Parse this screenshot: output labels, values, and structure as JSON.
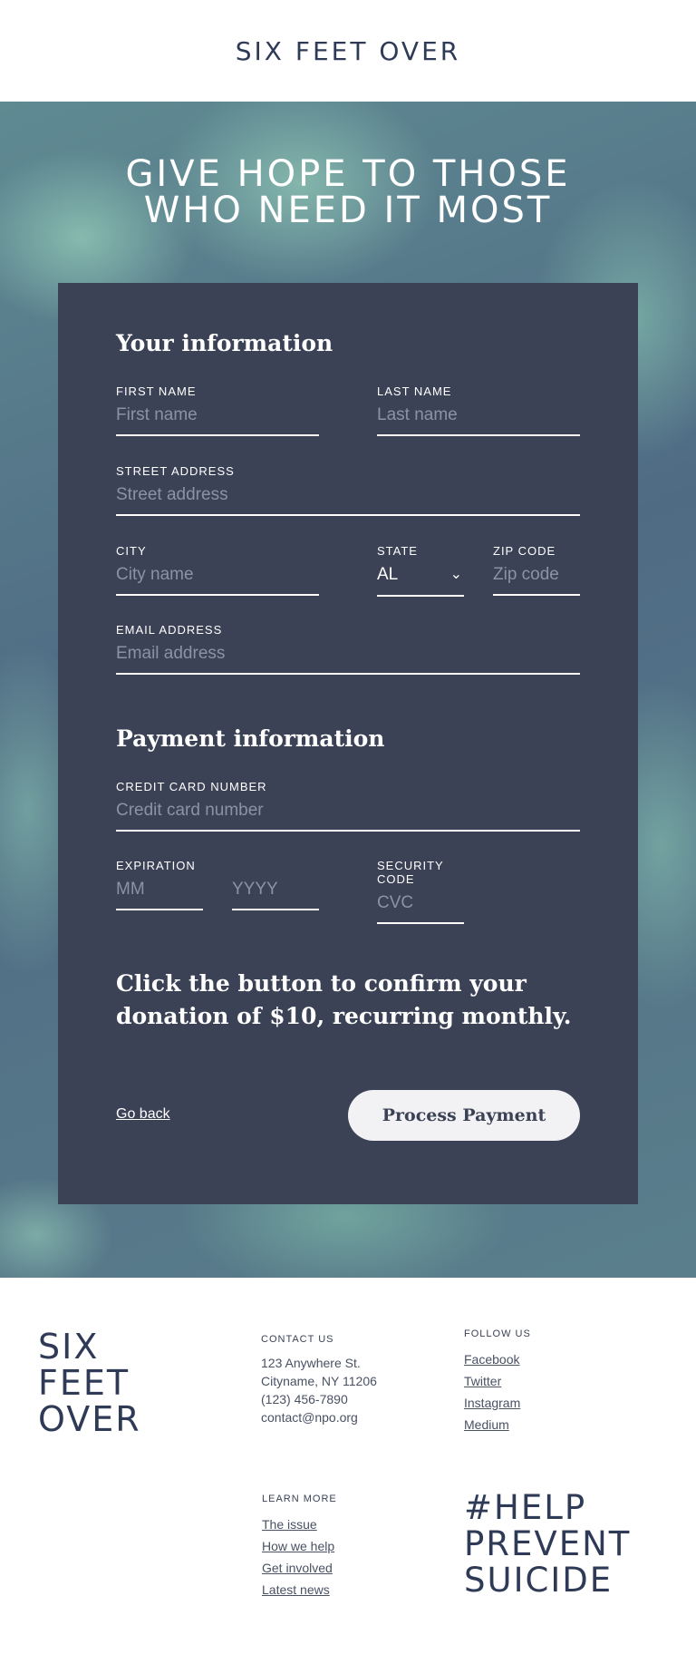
{
  "header": {
    "brand": "SIX FEET OVER"
  },
  "hero": {
    "title_line1": "GIVE HOPE TO THOSE",
    "title_line2": "WHO NEED IT MOST"
  },
  "form": {
    "your_info_heading": "Your information",
    "first_name": {
      "label": "FIRST NAME",
      "placeholder": "First name"
    },
    "last_name": {
      "label": "LAST NAME",
      "placeholder": "Last name"
    },
    "street": {
      "label": "STREET ADDRESS",
      "placeholder": "Street address"
    },
    "city": {
      "label": "CITY",
      "placeholder": "City name"
    },
    "state": {
      "label": "STATE",
      "value": "AL"
    },
    "zip": {
      "label": "ZIP CODE",
      "placeholder": "Zip code"
    },
    "email": {
      "label": "EMAIL ADDRESS",
      "placeholder": "Email address"
    },
    "payment_heading": "Payment information",
    "card": {
      "label": "CREDIT CARD NUMBER",
      "placeholder": "Credit card number"
    },
    "expiration": {
      "label": "EXPIRATION",
      "month_placeholder": "MM",
      "year_placeholder": "YYYY"
    },
    "security": {
      "label": "SECURITY CODE",
      "placeholder": "CVC"
    },
    "confirm_text": "Click the button to confirm your donation of $10, recurring monthly.",
    "go_back": "Go back",
    "submit": "Process Payment"
  },
  "footer": {
    "logo_line1": "SIX",
    "logo_line2": "FEET",
    "logo_line3": "OVER",
    "contact": {
      "heading": "CONTACT US",
      "address1": "123 Anywhere St.",
      "address2": "Cityname, NY 11206",
      "phone": "(123) 456-7890",
      "email": "contact@npo.org"
    },
    "follow": {
      "heading": "FOLLOW US",
      "links": [
        "Facebook",
        "Twitter",
        "Instagram",
        "Medium"
      ]
    },
    "learn": {
      "heading": "LEARN MORE",
      "links": [
        "The issue",
        "How we help",
        "Get involved",
        "Latest news"
      ]
    },
    "hashtag_line1": "#HELP",
    "hashtag_line2": "PREVENT",
    "hashtag_line3": "SUICIDE"
  }
}
